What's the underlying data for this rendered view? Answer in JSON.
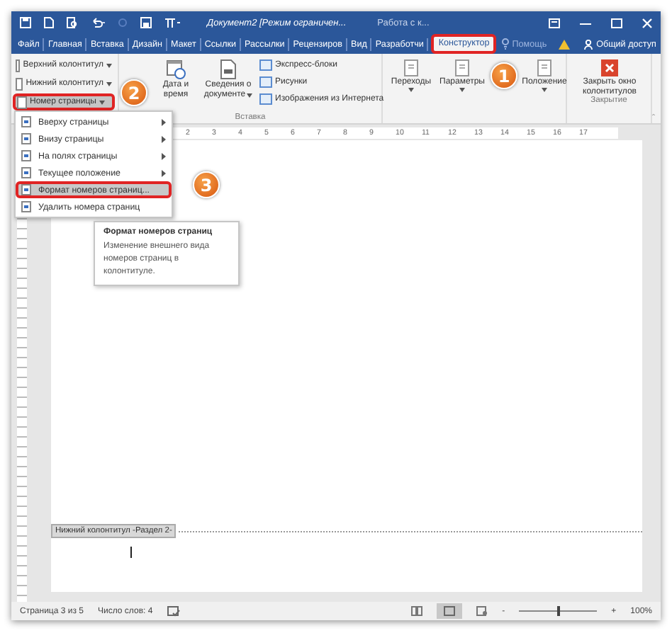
{
  "window": {
    "title": "Документ2 [Режим ограничен...",
    "context_title": "Работа с к..."
  },
  "tabs": [
    {
      "label": "Файл",
      "selected": false
    },
    {
      "label": "Главная",
      "selected": false
    },
    {
      "label": "Вставка",
      "selected": false
    },
    {
      "label": "Дизайн",
      "selected": false
    },
    {
      "label": "Макет",
      "selected": false
    },
    {
      "label": "Ссылки",
      "selected": false
    },
    {
      "label": "Рассылки",
      "selected": false
    },
    {
      "label": "Рецензиров",
      "selected": false
    },
    {
      "label": "Вид",
      "selected": false
    },
    {
      "label": "Разработчи",
      "selected": false
    },
    {
      "label": "Конструктор",
      "selected": true
    }
  ],
  "help": "Помощь",
  "share": "Общий доступ",
  "header_footer": [
    {
      "label": "Верхний колонтитул",
      "selected": false
    },
    {
      "label": "Нижний колонтитул",
      "selected": false
    },
    {
      "label": "Номер страницы",
      "selected": true
    }
  ],
  "insert": {
    "date_time": [
      "Дата и",
      "время"
    ],
    "doc_info": [
      "Сведения о",
      "документе"
    ],
    "small": [
      "Экспресс-блоки",
      "Рисунки",
      "Изображения из Интернета"
    ],
    "group": "Вставка"
  },
  "navigation": [
    "Переходы",
    "Параметры",
    "Положение"
  ],
  "close": {
    "label": [
      "Закрыть окно",
      "колонтитулов"
    ],
    "group": "Закрытие"
  },
  "ruler": [
    "2",
    "3",
    "4",
    "5",
    "6",
    "7",
    "8",
    "9",
    "10",
    "11",
    "12",
    "13",
    "14",
    "15",
    "16",
    "17"
  ],
  "menu": [
    {
      "label": "Вверху страницы",
      "submenu": true,
      "selected": false
    },
    {
      "label": "Внизу страницы",
      "submenu": true,
      "selected": false
    },
    {
      "label": "На полях страницы",
      "submenu": true,
      "selected": false
    },
    {
      "label": "Текущее положение",
      "submenu": true,
      "selected": false
    },
    {
      "label": "Формат номеров страниц...",
      "submenu": false,
      "selected": true
    },
    {
      "label": "Удалить номера страниц",
      "submenu": false,
      "selected": false
    }
  ],
  "tooltip": {
    "title": "Формат номеров страниц",
    "body": "Изменение внешнего вида номеров страниц в колонтитуле."
  },
  "footer_label": "Нижний колонтитул -Раздел 2-",
  "badges": [
    "1",
    "2",
    "3"
  ],
  "status_bar": {
    "page": "Страница 3 из 5",
    "words": "Число слов: 4",
    "zoom_out": "-",
    "zoom_in": "+",
    "zoom": "100%",
    "zoom_slider": {
      "level": 0.5
    }
  }
}
